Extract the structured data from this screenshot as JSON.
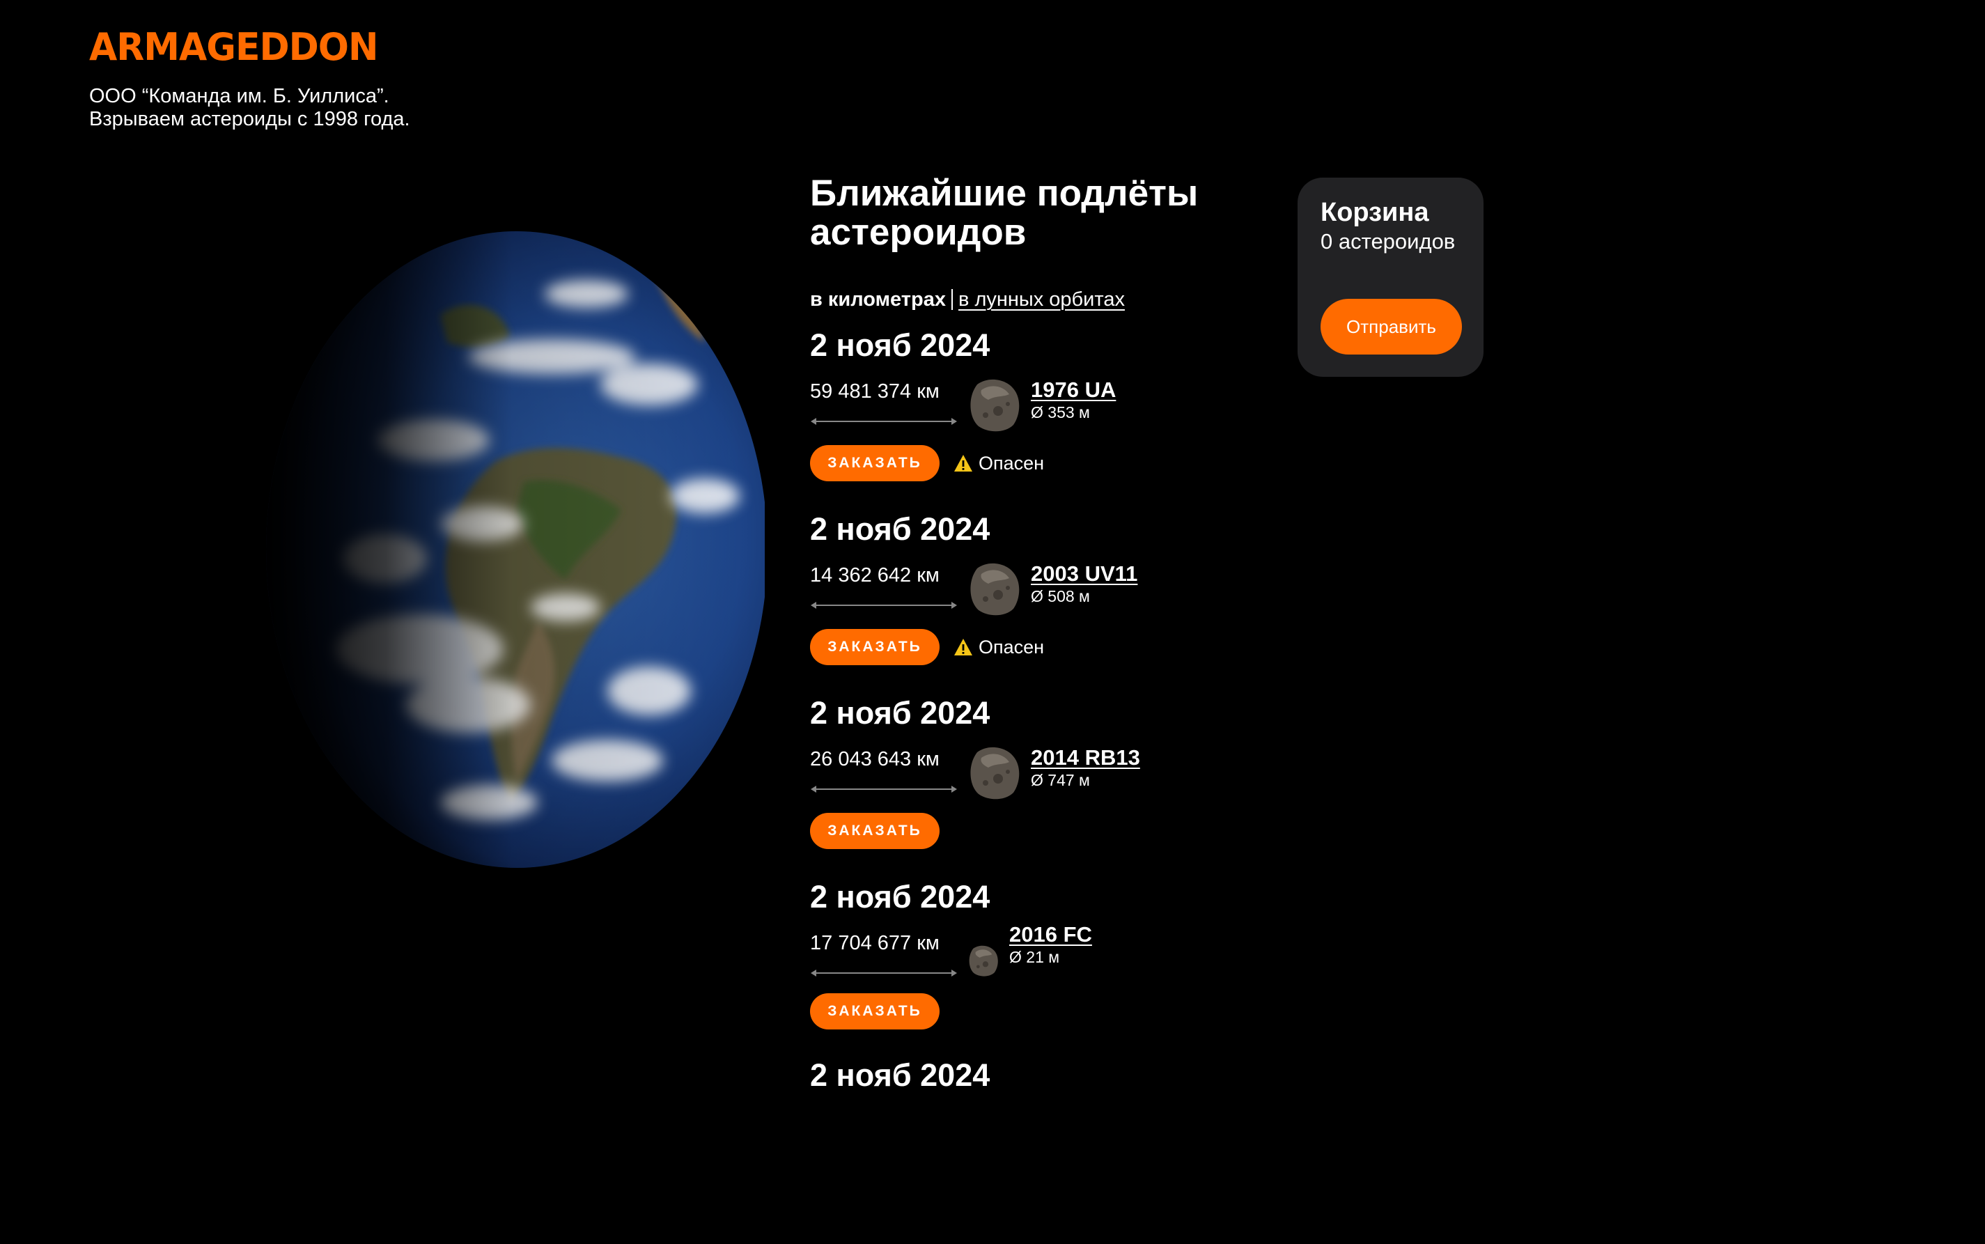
{
  "header": {
    "logo": "ARMAGEDDON",
    "tagline_line1": "ООО “Команда им. Б. Уиллиса”.",
    "tagline_line2": "Взрываем астероиды с 1998 года."
  },
  "main": {
    "title_line1": "Ближайшие подлёты",
    "title_line2": "астероидов",
    "units_active": "в километрах",
    "units_alt": "в лунных орбитах"
  },
  "asteroids": [
    {
      "date": "2 нояб 2024",
      "distance": "59 481 374 км",
      "name": "1976 UA",
      "diameter": "Ø 353 м",
      "order": "ЗАКАЗАТЬ",
      "danger": "Опасен"
    },
    {
      "date": "2 нояб 2024",
      "distance": "14 362 642 км",
      "name": "2003 UV11",
      "diameter": "Ø 508 м",
      "order": "ЗАКАЗАТЬ",
      "danger": "Опасен"
    },
    {
      "date": "2 нояб 2024",
      "distance": "26 043 643 км",
      "name": "2014 RB13",
      "diameter": "Ø 747 м",
      "order": "ЗАКАЗАТЬ",
      "danger": ""
    },
    {
      "date": "2 нояб 2024",
      "distance": "17 704 677 км",
      "name": "2016 FC",
      "diameter": "Ø 21 м",
      "order": "ЗАКАЗАТЬ",
      "danger": ""
    },
    {
      "date": "2 нояб 2024"
    }
  ],
  "cart": {
    "title": "Корзина",
    "count": "0 астероидов",
    "send": "Отправить"
  },
  "colors": {
    "accent": "#ff6b00",
    "background": "#000000",
    "cart_bg": "#222224"
  }
}
